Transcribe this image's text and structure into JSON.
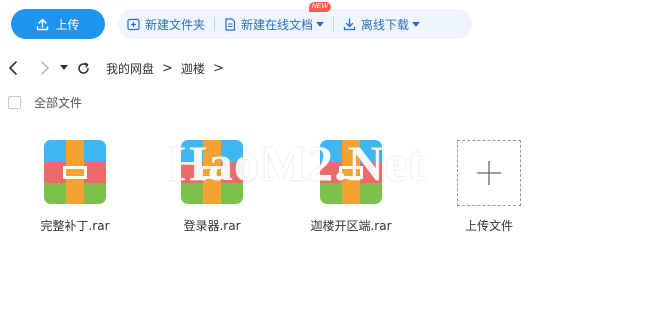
{
  "toolbar": {
    "upload_label": "上传",
    "new_folder_label": "新建文件夹",
    "new_online_doc_label": "新建在线文档",
    "new_badge": "NEW",
    "offline_download_label": "离线下载"
  },
  "breadcrumb": {
    "root": "我的网盘",
    "current": "迦楼"
  },
  "select_all_label": "全部文件",
  "files": [
    {
      "name": "完整补丁.rar",
      "icon": "rar-archive-icon"
    },
    {
      "name": "登录器.rar",
      "icon": "rar-archive-icon"
    },
    {
      "name": "迦楼开区端.rar",
      "icon": "rar-archive-icon"
    }
  ],
  "upload_tile_label": "上传文件",
  "watermark": "HaoM2.Net",
  "colors": {
    "primary": "#1f95f2",
    "toolbar_bg": "#eef5fe",
    "toolbar_text": "#2c6fc6",
    "badge": "#ff5a4a",
    "rar_blue": "#3db7f3",
    "rar_orange": "#f4a231",
    "rar_red": "#ee6a6a",
    "rar_green": "#7dc14c"
  }
}
